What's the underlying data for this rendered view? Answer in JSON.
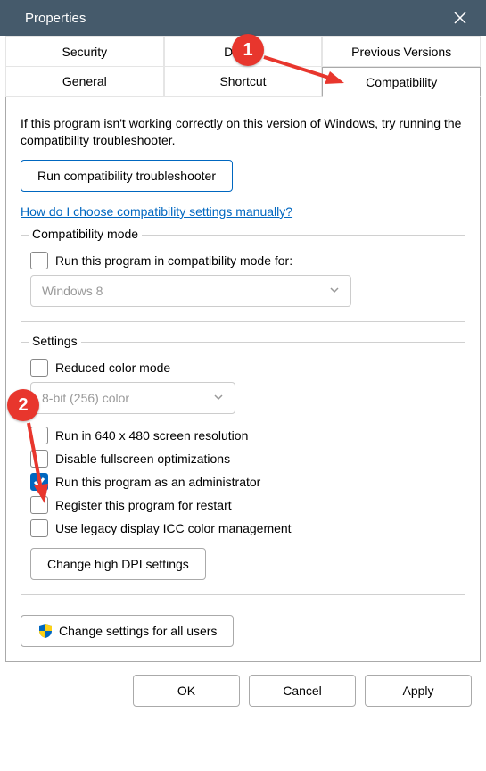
{
  "window": {
    "title": "Properties"
  },
  "tabs": {
    "top": [
      "Security",
      "Details",
      "Previous Versions"
    ],
    "bottom": [
      "General",
      "Shortcut",
      "Compatibility"
    ],
    "active": "Compatibility"
  },
  "intro": "If this program isn't working correctly on this version of Windows, try running the compatibility troubleshooter.",
  "troubleshoot_btn": "Run compatibility troubleshooter",
  "help_link": "How do I choose compatibility settings manually?",
  "compat_mode": {
    "legend": "Compatibility mode",
    "check_label": "Run this program in compatibility mode for:",
    "select_value": "Windows 8"
  },
  "settings": {
    "legend": "Settings",
    "reduced_color": "Reduced color mode",
    "color_select": "8-bit (256) color",
    "run_640": "Run in 640 x 480 screen resolution",
    "disable_fullscreen": "Disable fullscreen optimizations",
    "run_admin": "Run this program as an administrator",
    "register_restart": "Register this program for restart",
    "legacy_icc": "Use legacy display ICC color management",
    "dpi_btn": "Change high DPI settings"
  },
  "all_users_btn": "Change settings for all users",
  "footer": {
    "ok": "OK",
    "cancel": "Cancel",
    "apply": "Apply"
  },
  "callouts": {
    "one": "1",
    "two": "2"
  }
}
